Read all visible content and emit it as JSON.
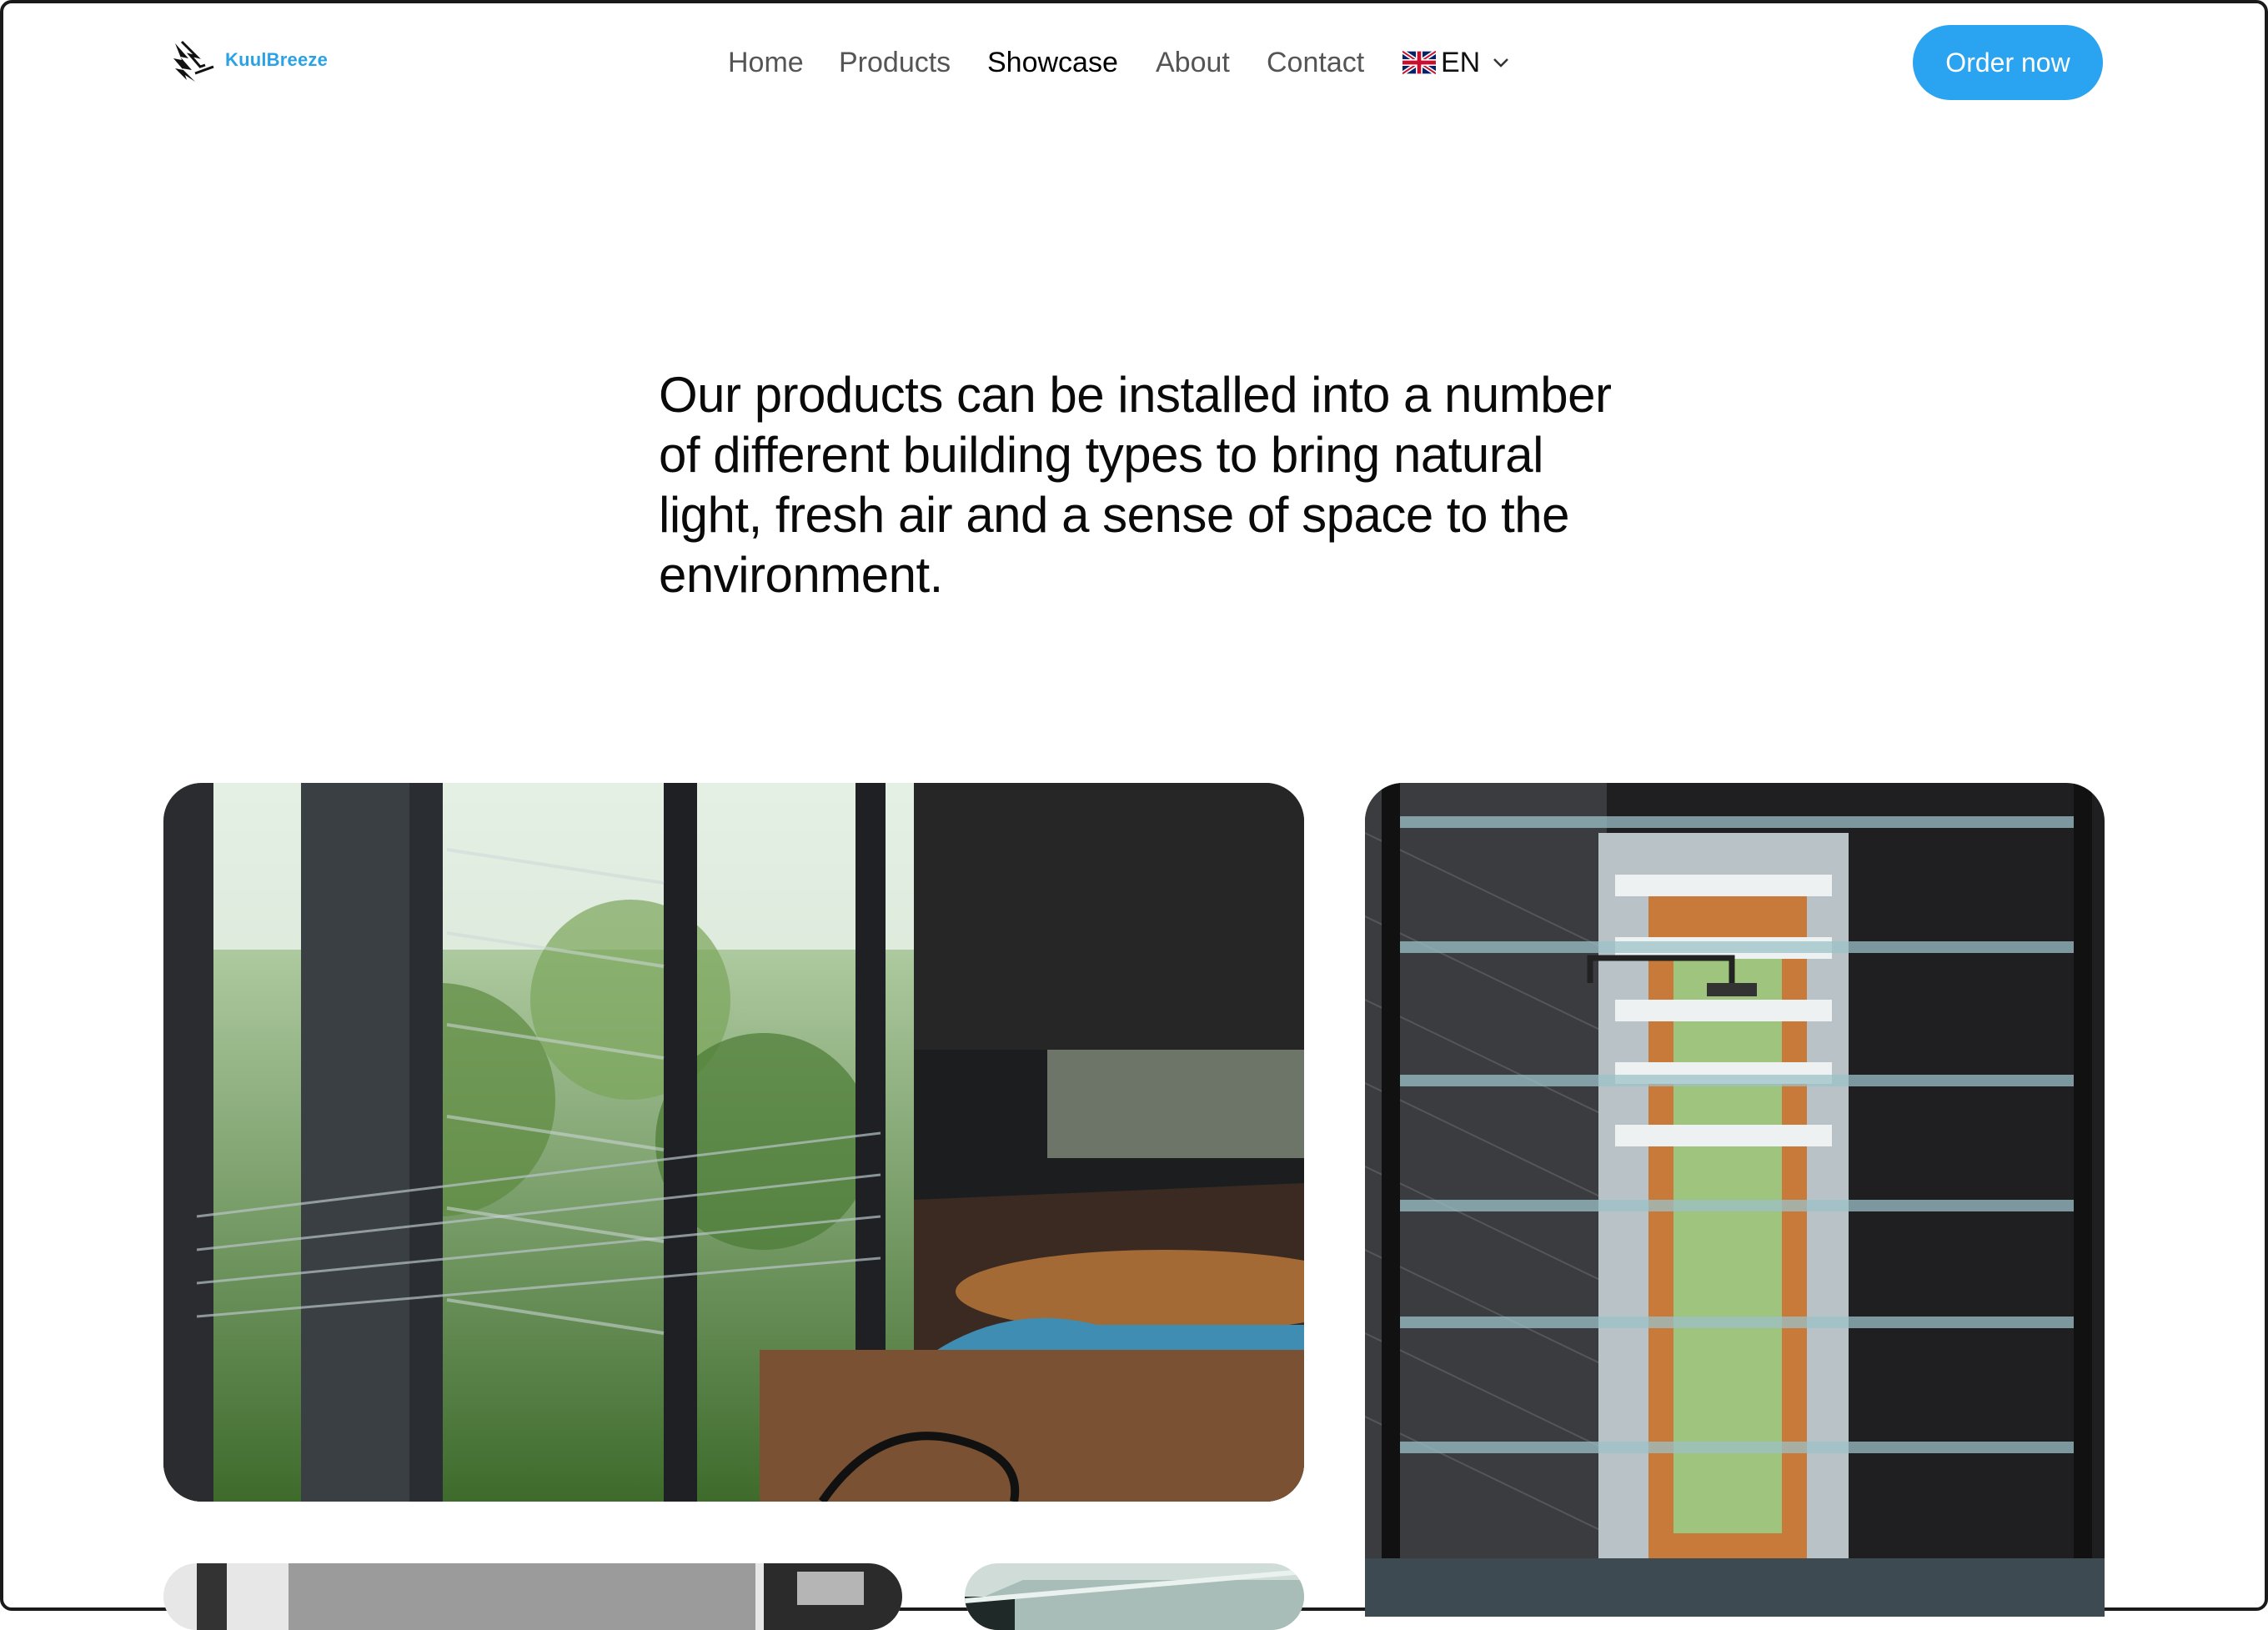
{
  "brand": {
    "name": "KuulBreeze",
    "accent_color": "#2aa3f0",
    "logo_icon": "kuulbreeze-logo-icon"
  },
  "nav": {
    "items": [
      {
        "label": "Home",
        "active": false
      },
      {
        "label": "Products",
        "active": false
      },
      {
        "label": "Showcase",
        "active": true
      },
      {
        "label": "About",
        "active": false
      },
      {
        "label": "Contact",
        "active": false
      }
    ],
    "language": {
      "code": "EN",
      "flag_icon": "uk-flag-icon",
      "dropdown_icon": "chevron-down-icon"
    }
  },
  "cta": {
    "label": "Order now"
  },
  "intro": {
    "text": "Our products can be installed into a number of different building types to bring natural light, fresh air and a sense of space to the environment."
  },
  "gallery": {
    "images": [
      {
        "subject": "restaurant-louvre-windows"
      },
      {
        "subject": "bathroom-glass-louvres"
      },
      {
        "subject": "interior-louvre-partial"
      },
      {
        "subject": "glass-louvre-partial"
      }
    ]
  }
}
